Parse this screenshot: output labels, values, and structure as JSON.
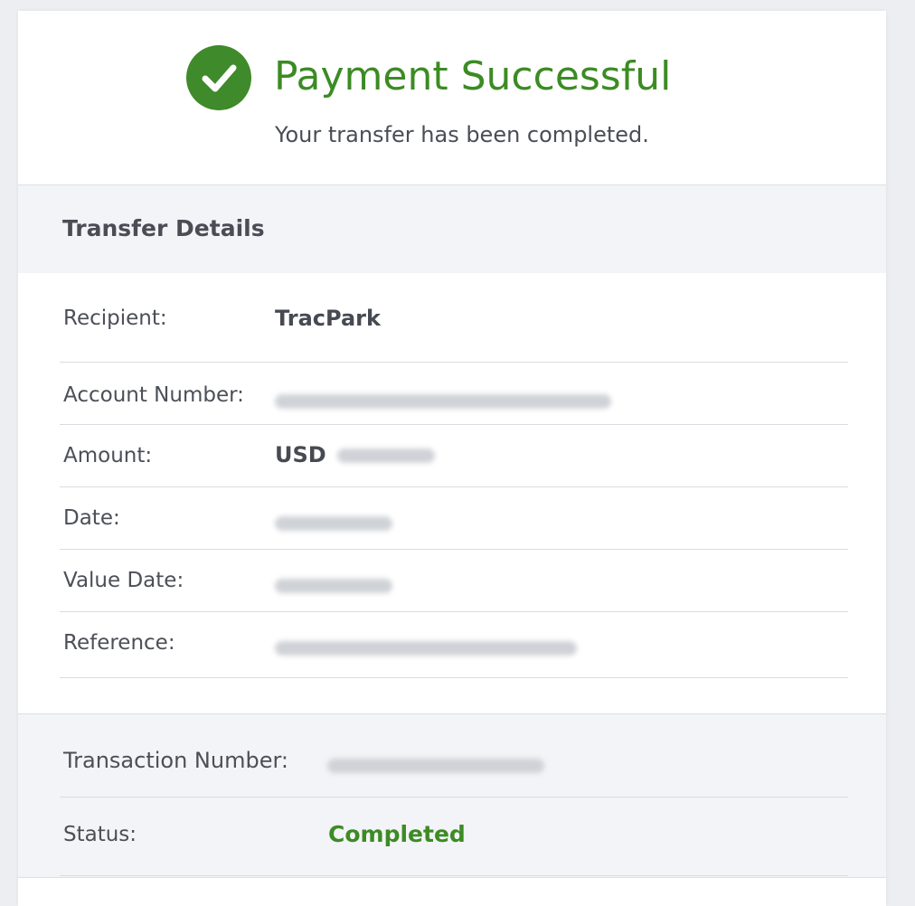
{
  "header": {
    "title": "Payment Successful",
    "subtitle": "Your transfer has been completed.",
    "icon": "check-circle-icon",
    "accent_color": "#3c8b24"
  },
  "details": {
    "section_title": "Transfer Details",
    "recipient_label": "Recipient:",
    "recipient_value": "TracPark",
    "account_label": "Account Number:",
    "amount_label": "Amount:",
    "amount_currency": "USD",
    "date_label": "Date:",
    "value_date_label": "Value Date:",
    "reference_label": "Reference:"
  },
  "summary": {
    "transaction_label": "Transaction Number:",
    "status_label": "Status:",
    "status_value": "Completed",
    "status_color": "#3c8b24"
  }
}
